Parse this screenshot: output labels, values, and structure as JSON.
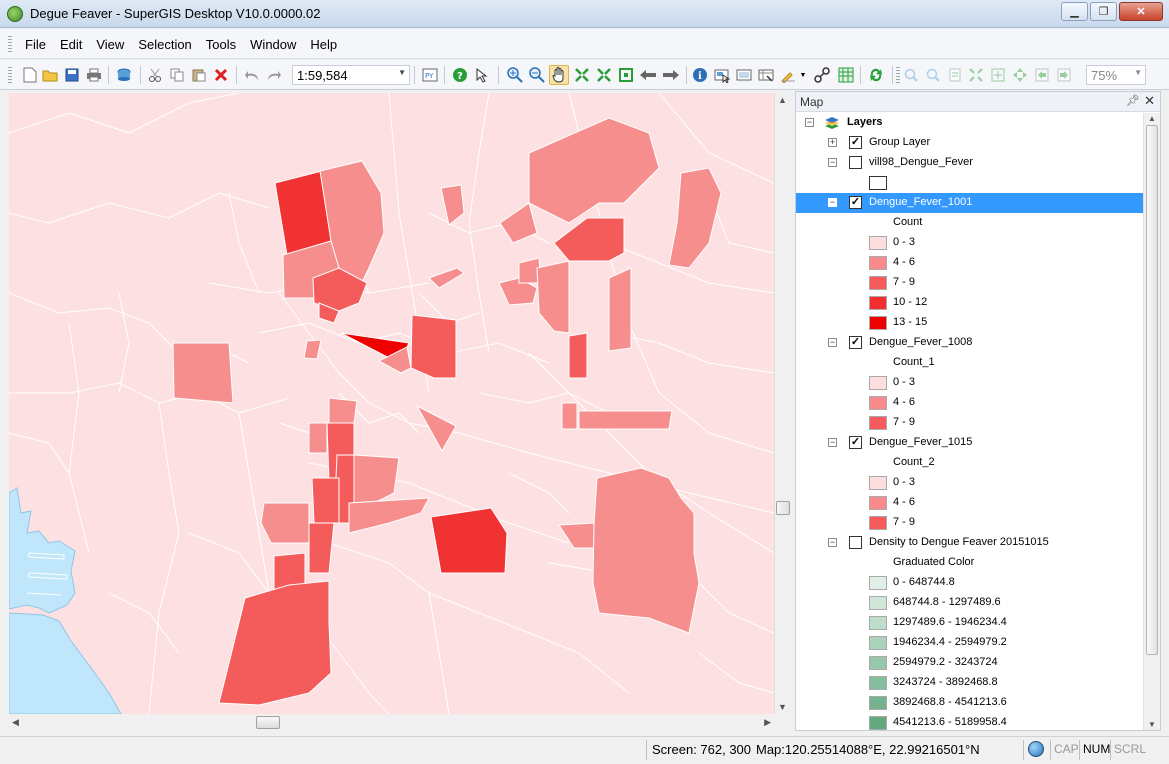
{
  "window": {
    "title": "Degue Feaver - SuperGIS Desktop V10.0.0000.02"
  },
  "menu": [
    "File",
    "Edit",
    "View",
    "Selection",
    "Tools",
    "Window",
    "Help"
  ],
  "toolbar": {
    "scale": "1:59,584",
    "zoom": "75%"
  },
  "toc": {
    "title": "Map",
    "root_label": "Layers",
    "group_layer": "Group Layer",
    "vill98": "vill98_Dengue_Fever",
    "layer1001": {
      "name": "Dengue_Fever_1001",
      "field": "Count",
      "classes": [
        {
          "label": "0 - 3",
          "color": "#fddede"
        },
        {
          "label": "4 - 6",
          "color": "#f88c8c"
        },
        {
          "label": "7 - 9",
          "color": "#f65a5a"
        },
        {
          "label": "10 - 12",
          "color": "#f42e2e"
        },
        {
          "label": "13 - 15",
          "color": "#ee0000"
        }
      ]
    },
    "layer1008": {
      "name": "Dengue_Fever_1008",
      "field": "Count_1",
      "classes": [
        {
          "label": "0 - 3",
          "color": "#fddede"
        },
        {
          "label": "4 - 6",
          "color": "#f88c8c"
        },
        {
          "label": "7 - 9",
          "color": "#f65a5a"
        }
      ]
    },
    "layer1015": {
      "name": "Dengue_Fever_1015",
      "field": "Count_2",
      "classes": [
        {
          "label": "0 - 3",
          "color": "#fddede"
        },
        {
          "label": "4 - 6",
          "color": "#f88c8c"
        },
        {
          "label": "7 - 9",
          "color": "#f65a5a"
        }
      ]
    },
    "density": {
      "name": "Density to Dengue Feaver 20151015",
      "field": "Graduated Color",
      "classes": [
        {
          "label": "0 - 648744.8",
          "color": "#e1f0e6"
        },
        {
          "label": "648744.8 - 1297489.6",
          "color": "#cfe6d8"
        },
        {
          "label": "1297489.6 - 1946234.4",
          "color": "#bddcca"
        },
        {
          "label": "1946234.4 - 2594979.2",
          "color": "#abd2bb"
        },
        {
          "label": "2594979.2 - 3243724",
          "color": "#98c7ac"
        },
        {
          "label": "3243724 - 3892468.8",
          "color": "#86bd9d"
        },
        {
          "label": "3892468.8 - 4541213.6",
          "color": "#74b38e"
        },
        {
          "label": "4541213.6 - 5189958.4",
          "color": "#62a97f"
        }
      ]
    }
  },
  "status": {
    "screen": "Screen: 762, 300",
    "map": "Map:120.25514088°E, 22.99216501°N",
    "cap": "CAP",
    "num": "NUM",
    "scrl": "SCRL"
  },
  "map_colors": {
    "base": "#fde0e2",
    "water": "#bfe6fb",
    "class_4_6": "#f78e8e",
    "class_7_9": "#f45c5c",
    "class_10_12": "#f03232",
    "class_13_15": "#ee0000"
  }
}
